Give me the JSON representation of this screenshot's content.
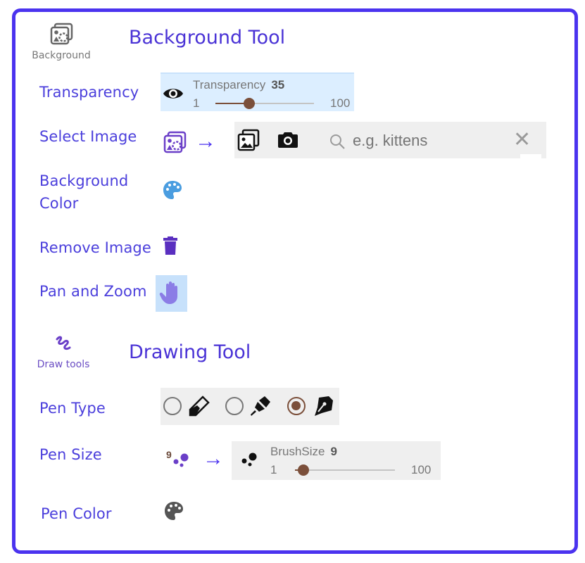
{
  "colors": {
    "frame_border": "#4b33ef",
    "label_text": "#4b3fdc",
    "slider_accent": "#7b4f3a",
    "blue_panel": "#dceeff",
    "gray_panel": "#efefef",
    "purple_icon": "#6a3fc8"
  },
  "background_section": {
    "tool_icon": "background-image-icon",
    "tool_caption": "Background",
    "title": "Background Tool",
    "rows": {
      "transparency": {
        "label": "Transparency",
        "icon": "eye-icon",
        "slider": {
          "title": "Transparency",
          "value": "35",
          "min": "1",
          "max": "100",
          "fraction": 0.343
        }
      },
      "select_image": {
        "label": "Select Image",
        "icon": "background-image-icon",
        "arrow": "→",
        "gallery_icon": "image-gallery-icon",
        "camera_icon": "camera-icon",
        "search_icon": "search-icon",
        "search_placeholder": "e.g. kittens",
        "clear_icon": "close-icon",
        "clear_glyph": "✕"
      },
      "background_color": {
        "label_line1": "Background",
        "label_line2": "Color",
        "icon": "palette-icon"
      },
      "remove_image": {
        "label": "Remove Image",
        "icon": "trash-icon"
      },
      "pan_zoom": {
        "label": "Pan and Zoom",
        "icon": "hand-icon"
      }
    }
  },
  "drawing_section": {
    "tool_icon": "squiggle-icon",
    "tool_caption": "Draw tools",
    "title": "Drawing Tool",
    "rows": {
      "pen_type": {
        "label": "Pen Type",
        "options": [
          {
            "name": "pencil",
            "icon": "pencil-icon",
            "selected": false
          },
          {
            "name": "marker",
            "icon": "marker-icon",
            "selected": false
          },
          {
            "name": "fountain-pen",
            "icon": "fountain-pen-icon",
            "selected": true
          }
        ]
      },
      "pen_size": {
        "label": "Pen Size",
        "badge_value": "9",
        "icon": "brush-size-icon",
        "arrow": "→",
        "slider": {
          "title": "BrushSize",
          "value": "9",
          "min": "1",
          "max": "100",
          "fraction": 0.081
        }
      },
      "pen_color": {
        "label": "Pen Color",
        "icon": "palette-icon"
      }
    }
  }
}
